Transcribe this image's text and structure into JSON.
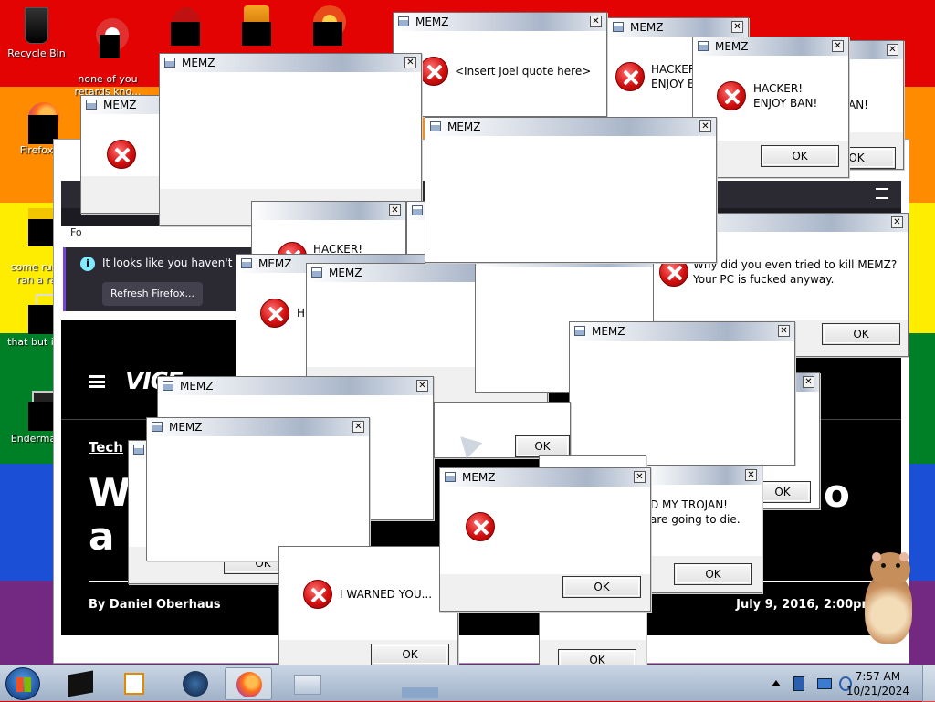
{
  "desktop": {
    "icons": [
      {
        "label": "Recycle Bin"
      },
      {
        "label": "none of you\nretards kno..."
      },
      {
        "label": ""
      },
      {
        "label": ""
      },
      {
        "label": ""
      },
      {
        "label": "Firefox"
      },
      {
        "label": "some russ\nran a ra"
      },
      {
        "label": "that but it's"
      },
      {
        "label": "Enderman"
      }
    ]
  },
  "browser": {
    "notification_text": "It looks like you haven't star",
    "refresh_button": "Refresh Firefox...",
    "left_frag": "Fo",
    "site_logo": "VICE",
    "site_section_frag": "M",
    "tag": "Tech",
    "headline_line1": "Wa",
    "headline_line2": "a l",
    "headline_end": "o",
    "byline": "By Daniel Oberhaus",
    "date": "July 9, 2016, 2:00pm",
    "right_frag": "s"
  },
  "dialogs": {
    "title": "MEMZ",
    "ok_label": "OK",
    "close_glyph": "✕",
    "joel": "<Insert Joel quote here>",
    "hacker_ban": "HACKER!\nENJOY BAN!",
    "hacker_frag": "HACKER!\nENJOY B",
    "hacker_short": "HACKER!",
    "h_frag": "H",
    "an_frag": "AN!",
    "kill_memz": "Why did you even tried to kill MEMZ?\nYour PC is fucked anyway.",
    "trojan": "D MY TROJAN!\nare going to die.",
    "warned": "I WARNED YOU..."
  },
  "taskbar": {
    "time": "7:57 AM",
    "date": "10/21/2024"
  }
}
